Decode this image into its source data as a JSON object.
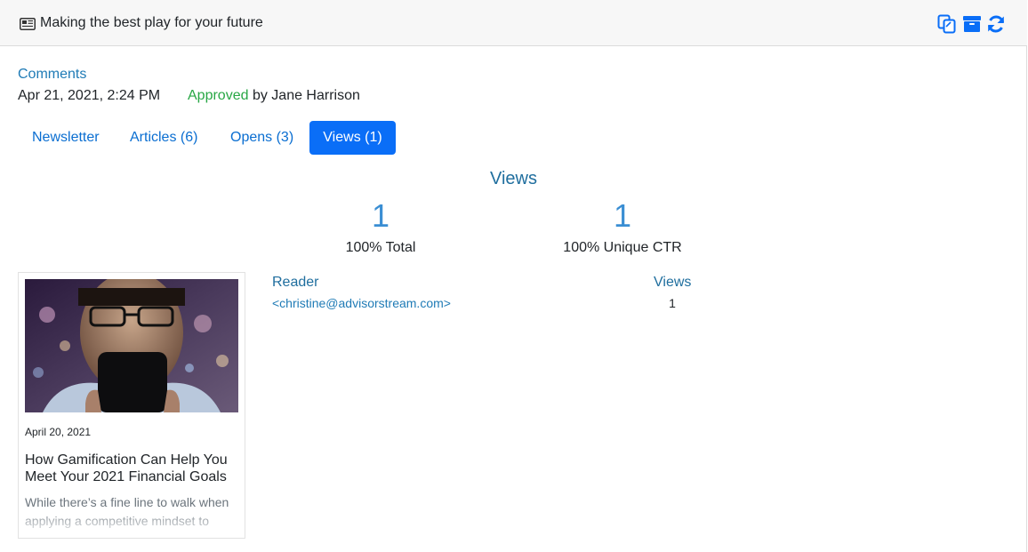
{
  "header": {
    "title": "Making the best play for your future",
    "actions": [
      {
        "name": "copy",
        "icon": "copy-icon"
      },
      {
        "name": "archive",
        "icon": "archive-icon"
      },
      {
        "name": "refresh",
        "icon": "refresh-icon"
      }
    ]
  },
  "meta": {
    "comments_label": "Comments",
    "date": "Apr 21, 2021, 2:24 PM",
    "status": "Approved",
    "by_text": " by Jane Harrison"
  },
  "tabs": [
    {
      "label": "Newsletter",
      "active": false
    },
    {
      "label": "Articles (6)",
      "active": false
    },
    {
      "label": "Opens (3)",
      "active": false
    },
    {
      "label": "Views (1)",
      "active": true
    }
  ],
  "views": {
    "title": "Views",
    "total": {
      "value": "1",
      "label": "100% Total"
    },
    "unique": {
      "value": "1",
      "label": "100% Unique CTR"
    }
  },
  "article": {
    "date": "April 20, 2021",
    "title": "How Gamification Can Help You Meet Your 2021 Financial Goals",
    "excerpt": "While there’s a fine line to walk when applying a competitive mindset to"
  },
  "table": {
    "headers": {
      "reader": "Reader",
      "views": "Views"
    },
    "rows": [
      {
        "reader": "<christine@advisorstream.com>",
        "views": "1"
      }
    ]
  },
  "colors": {
    "accent": "#0a6ef7",
    "link": "#1f7bb6",
    "approved": "#28a745",
    "stat": "#3a8ed3"
  }
}
